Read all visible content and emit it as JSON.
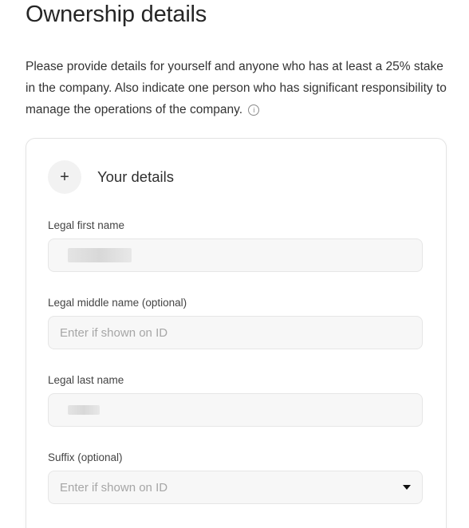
{
  "header": {
    "title": "Ownership details",
    "description": "Please provide details for yourself and anyone who has at least a 25% stake in the company. Also indicate one person who has significant responsibility to manage the operations of the company.",
    "info_icon": "info-icon"
  },
  "card": {
    "expand_icon": "+",
    "title": "Your details",
    "fields": {
      "first_name": {
        "label": "Legal first name",
        "value": "",
        "redacted": true
      },
      "middle_name": {
        "label": "Legal middle name (optional)",
        "placeholder": "Enter if shown on ID"
      },
      "last_name": {
        "label": "Legal last name",
        "value": "",
        "redacted": true
      },
      "suffix": {
        "label": "Suffix (optional)",
        "placeholder": "Enter if shown on ID"
      }
    }
  }
}
